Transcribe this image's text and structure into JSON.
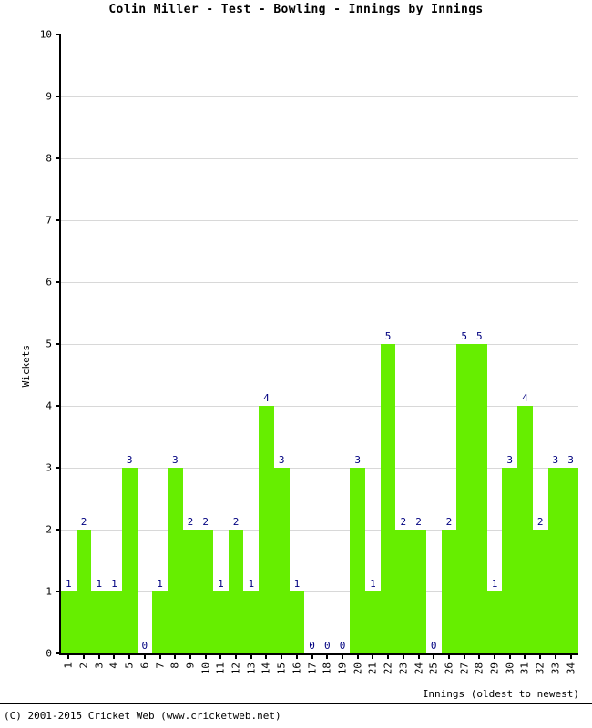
{
  "chart_data": {
    "type": "bar",
    "title": "Colin Miller - Test - Bowling - Innings by Innings",
    "xlabel": "Innings (oldest to newest)",
    "ylabel": "Wickets",
    "ylim": [
      0,
      10
    ],
    "ytick_values": [
      0,
      1,
      2,
      3,
      4,
      5,
      6,
      7,
      8,
      9,
      10
    ],
    "ytick_labels": [
      "0",
      "1",
      "2",
      "3",
      "4",
      "5",
      "6",
      "7",
      "8",
      "9",
      "10"
    ],
    "grid": true,
    "legend": null,
    "bar_color": "#66ee00",
    "label_color": "#000080",
    "categories": [
      "1",
      "2",
      "3",
      "4",
      "5",
      "6",
      "7",
      "8",
      "9",
      "10",
      "11",
      "12",
      "13",
      "14",
      "15",
      "16",
      "17",
      "18",
      "19",
      "20",
      "21",
      "22",
      "23",
      "24",
      "25",
      "26",
      "27",
      "28",
      "29",
      "30",
      "31",
      "32",
      "33",
      "34"
    ],
    "values": [
      1,
      2,
      1,
      1,
      3,
      0,
      1,
      3,
      2,
      2,
      1,
      2,
      1,
      4,
      3,
      1,
      0,
      0,
      0,
      3,
      1,
      5,
      2,
      2,
      0,
      2,
      5,
      5,
      1,
      3,
      4,
      2,
      3,
      3
    ],
    "point_labels": [
      "1",
      "2",
      "1",
      "1",
      "3",
      "0",
      "1",
      "3",
      "2",
      "2",
      "1",
      "2",
      "1",
      "4",
      "3",
      "1",
      "0",
      "0",
      "0",
      "3",
      "1",
      "5",
      "2",
      "2",
      "0",
      "2",
      "5",
      "5",
      "1",
      "3",
      "4",
      "2",
      "3",
      "3"
    ]
  },
  "footer": {
    "copyright": "(C) 2001-2015 Cricket Web (www.cricketweb.net)"
  }
}
